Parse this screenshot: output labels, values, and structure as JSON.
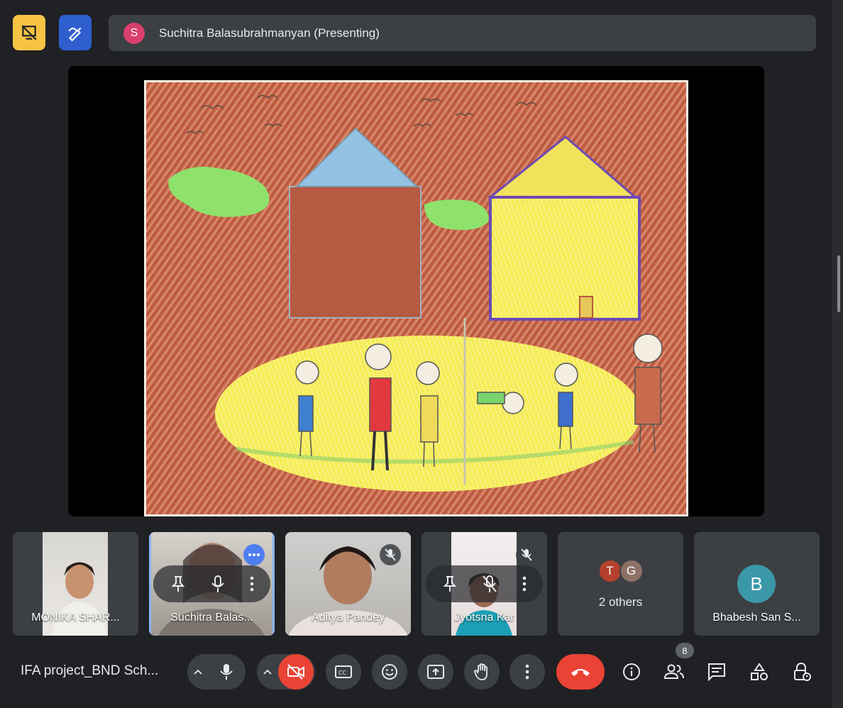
{
  "presenter": {
    "avatar_letter": "S",
    "label": "Suchitra Balasubrahmanyan (Presenting)"
  },
  "tiles": [
    {
      "name": "MONIKA SHAR...",
      "muted": false
    },
    {
      "name": "Suchitra Balas...",
      "muted": false,
      "active": true
    },
    {
      "name": "Aditya Pandey",
      "muted": true
    },
    {
      "name": "Jyotsna Kar",
      "muted": true
    }
  ],
  "others": {
    "avatars": [
      {
        "letter": "T",
        "color": "#b5412c"
      },
      {
        "letter": "G",
        "color": "#8d7168"
      }
    ],
    "label": "2 others"
  },
  "bhabesh": {
    "letter": "B",
    "name": "Bhabesh San S..."
  },
  "controls": {
    "meeting_title": "IFA project_BND Sch...",
    "participants_count": "8"
  },
  "colors": {
    "background": "#202124",
    "tile": "#3c4043",
    "accent_blue": "#8ab4f8",
    "danger_red": "#ea4335",
    "highlight_yellow": "#f6c343"
  }
}
